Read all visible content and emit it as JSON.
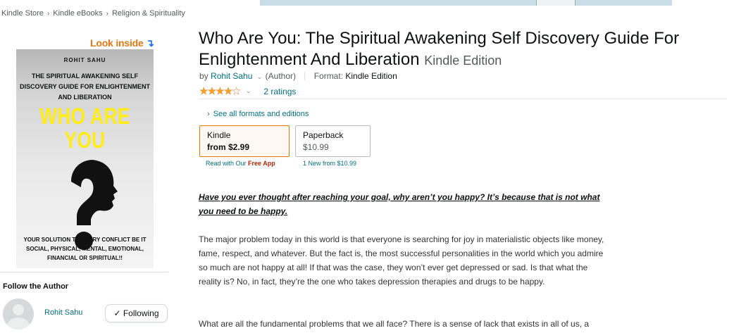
{
  "breadcrumb": [
    "Kindle Store",
    "Kindle eBooks",
    "Religion & Spirituality"
  ],
  "look_inside": {
    "label": "Look inside",
    "arrow": "↴"
  },
  "cover": {
    "author": "ROHIT SAHU",
    "subtitle": "THE SPIRITUAL AWAKENING SELF DISCOVERY GUIDE FOR ENLIGHTENMENT AND LIBERATION",
    "big_title": "WHO ARE YOU",
    "tagline": "YOUR SOLUTION TO EVERY CONFLICT BE IT SOCIAL, PHYSICAL, MENTAL, EMOTIONAL, FINANCIAL OR SPIRITUAL!!"
  },
  "follow": {
    "title": "Follow the Author",
    "author_name": "Rohit Sahu",
    "button_label": "✓ Following"
  },
  "product": {
    "title": "Who Are You: The Spiritual Awakening Self Discovery Guide For Enlightenment And Liberation",
    "edition": "Kindle Edition",
    "by_prefix": "by",
    "author": "Rohit Sahu",
    "author_role": "(Author)",
    "format_label": "Format:",
    "format_value": "Kindle Edition",
    "rating_stars": 4,
    "rating_max": 5,
    "ratings_count": "2 ratings",
    "see_all": "See all formats and editions"
  },
  "formats": {
    "kindle": {
      "name": "Kindle",
      "price": "from $2.99",
      "sub_prefix": "Read with Our",
      "sub_highlight": "Free App"
    },
    "paperback": {
      "name": "Paperback",
      "price": "$10.99",
      "sub": "1 New from $10.99"
    }
  },
  "description": {
    "hook": "Have you ever thought after reaching your goal, why aren’t you happy? It’s because that is not what you need to be happy.",
    "paragraph1": "The major problem today in this world is that everyone is searching for joy in materialistic objects like money, fame, respect, and whatever. But the fact is, the most successful personalities in the world which you admire so much are not happy at all! If that was the case, they won’t ever get depressed or sad. Is that what the reality is? No, in fact, they’re the one who takes depression therapies and drugs to be happy.",
    "paragraph2": "What are all the fundamental problems that we all face? There is a sense of lack that exists in all of us, a"
  },
  "colors": {
    "link": "#007185",
    "star": "#ffa41c",
    "kindle_border": "#e77600",
    "look_inside": "#e47911",
    "cover_title": "#ffec1a",
    "free_app": "#b12704"
  }
}
